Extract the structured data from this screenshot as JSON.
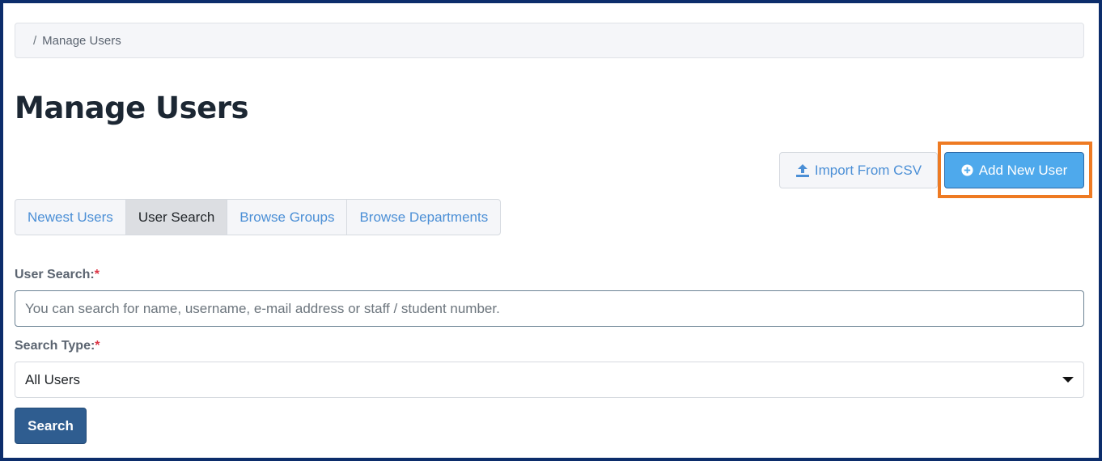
{
  "breadcrumb": {
    "separator": "/",
    "current": "Manage Users"
  },
  "page": {
    "title": "Manage Users"
  },
  "actions": {
    "import_label": "Import From CSV",
    "add_label": "Add New User"
  },
  "tabs": [
    {
      "label": "Newest Users",
      "active": false
    },
    {
      "label": "User Search",
      "active": true
    },
    {
      "label": "Browse Groups",
      "active": false
    },
    {
      "label": "Browse Departments",
      "active": false
    }
  ],
  "form": {
    "user_search": {
      "label": "User Search:",
      "required_mark": "*",
      "placeholder": "You can search for name, username, e-mail address or staff / student number."
    },
    "search_type": {
      "label": "Search Type:",
      "required_mark": "*",
      "selected": "All Users"
    },
    "submit_label": "Search"
  },
  "colors": {
    "accent": "#4ea9ec",
    "highlight": "#ee7a22",
    "primary_dark": "#2f5d90",
    "frame": "#0c2d6b"
  }
}
